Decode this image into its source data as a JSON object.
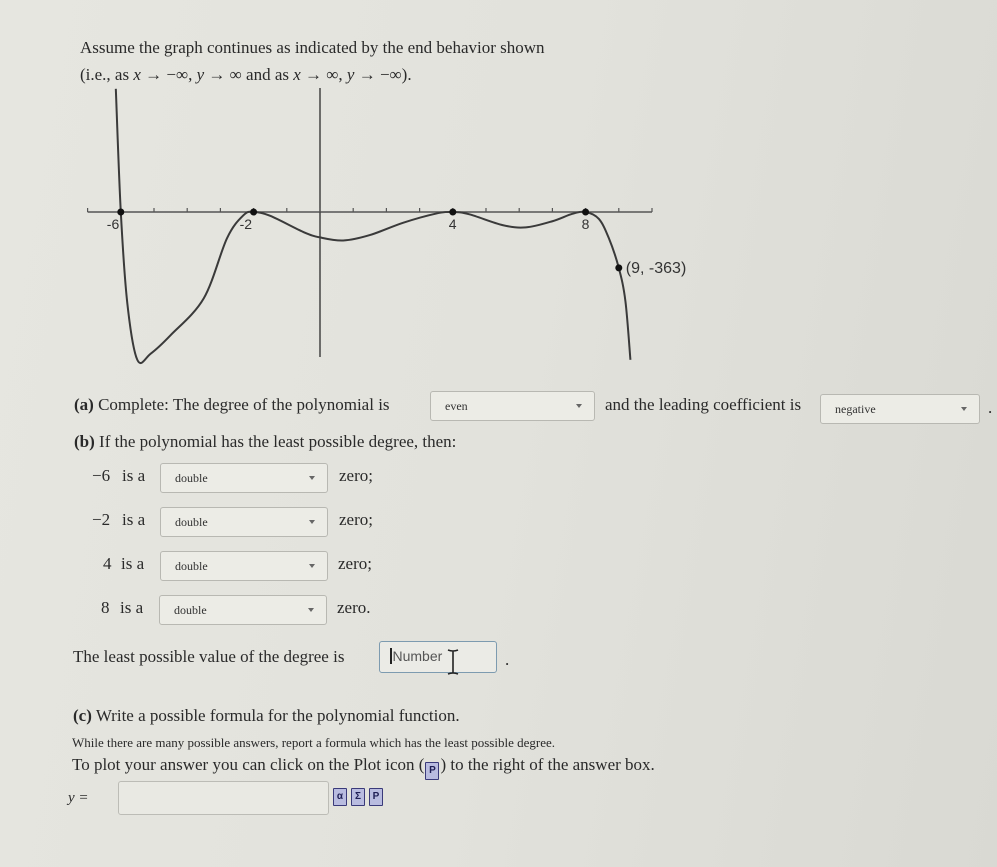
{
  "intro": {
    "line1": "Assume the graph continues as indicated by the end behavior shown",
    "line2_parts": [
      "(i.e., as ",
      "x",
      " → −∞, ",
      "y",
      " → ∞ and as ",
      "x",
      " → ∞, ",
      "y",
      " → −∞)."
    ]
  },
  "chart_data": {
    "type": "line",
    "title": "",
    "xlabel": "",
    "ylabel": "",
    "xlim": [
      -7,
      10
    ],
    "x_tick_step": 1,
    "grid": false,
    "labeled_points": [
      {
        "x": -6,
        "y": 0,
        "label": "-6"
      },
      {
        "x": -2,
        "y": 0,
        "label": "-2"
      },
      {
        "x": 4,
        "y": 0,
        "label": "4"
      },
      {
        "x": 8,
        "y": 0,
        "label": "8"
      },
      {
        "x": 9,
        "y": -363,
        "label": "(9, -363)"
      }
    ],
    "curve_samples": [
      {
        "x": -6.15,
        "y": 800
      },
      {
        "x": -6,
        "y": 0
      },
      {
        "x": -5.8,
        "y": -600
      },
      {
        "x": -5.5,
        "y": -1150
      },
      {
        "x": -5.1,
        "y": -920
      },
      {
        "x": -4.5,
        "y": -800
      },
      {
        "x": -3.5,
        "y": -560
      },
      {
        "x": -2.8,
        "y": -170
      },
      {
        "x": -2.3,
        "y": -20
      },
      {
        "x": -2,
        "y": 0
      },
      {
        "x": -1.5,
        "y": -25
      },
      {
        "x": -0.5,
        "y": -130
      },
      {
        "x": 0,
        "y": -165
      },
      {
        "x": 0.7,
        "y": -185
      },
      {
        "x": 1.5,
        "y": -150
      },
      {
        "x": 2.5,
        "y": -70
      },
      {
        "x": 3.5,
        "y": -10
      },
      {
        "x": 4,
        "y": 0
      },
      {
        "x": 4.5,
        "y": -15
      },
      {
        "x": 5.5,
        "y": -85
      },
      {
        "x": 6.2,
        "y": -100
      },
      {
        "x": 7,
        "y": -60
      },
      {
        "x": 7.6,
        "y": -12
      },
      {
        "x": 8,
        "y": 0
      },
      {
        "x": 8.4,
        "y": -45
      },
      {
        "x": 8.7,
        "y": -170
      },
      {
        "x": 9,
        "y": -363
      },
      {
        "x": 9.2,
        "y": -580
      },
      {
        "x": 9.35,
        "y": -960
      }
    ],
    "end_behavior": {
      "left": "y → ∞",
      "right": "y → −∞"
    }
  },
  "part_a": {
    "label": "(a)",
    "text1": " Complete: The degree of the polynomial is",
    "degree_parity": "even",
    "text2": "and the leading coefficient is",
    "leading_coefficient": "negative",
    "end": "."
  },
  "part_b": {
    "label": "(b)",
    "text": " If the polynomial has the least possible degree, then:",
    "zeros": [
      {
        "value": "−6",
        "is_a": "is a",
        "multiplicity": "double",
        "suffix": "zero;"
      },
      {
        "value": "−2",
        "is_a": "is a",
        "multiplicity": "double",
        "suffix": "zero;"
      },
      {
        "value": "4",
        "is_a": "is a",
        "multiplicity": "double",
        "suffix": "zero;"
      },
      {
        "value": "8",
        "is_a": "is a",
        "multiplicity": "double",
        "suffix": "zero."
      }
    ],
    "least_degree_text": "The least possible value of the degree is",
    "least_degree_placeholder": "Number",
    "least_degree_end": "."
  },
  "part_c": {
    "label": "(c)",
    "text": " Write a possible formula for the polynomial function.",
    "note": "While there are many possible answers, report a formula which has the least possible degree.",
    "plot_hint_1": "To plot your answer you can click on the Plot icon (",
    "plot_hint_2": ") to the right of the answer box.",
    "answer_label": "y =",
    "answer_value": "",
    "icons": [
      {
        "name": "preview-icon",
        "glyph": "α"
      },
      {
        "name": "sigma-icon",
        "glyph": "Σ"
      },
      {
        "name": "plot-icon",
        "glyph": "P"
      }
    ]
  }
}
